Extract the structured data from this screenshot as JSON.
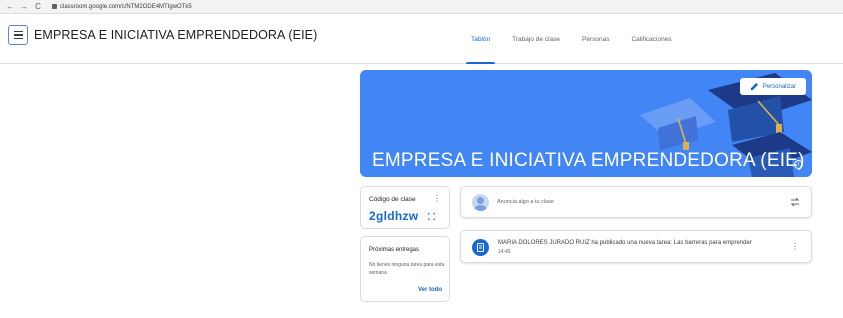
{
  "browser": {
    "back_glyph": "←",
    "forward_glyph": "→",
    "reload_glyph": "C",
    "url": "classroom.google.com/c/NTM2ODE4MTIgwOTk5"
  },
  "header": {
    "menu_icon": "hamburger-menu-icon",
    "class_title": "EMPRESA E INICIATIVA EMPRENDEDORA (EIE)",
    "tabs": [
      {
        "label": "Tablón",
        "active": true
      },
      {
        "label": "Trabajo de clase",
        "active": false
      },
      {
        "label": "Personas",
        "active": false
      },
      {
        "label": "Calificaciones",
        "active": false
      }
    ]
  },
  "banner": {
    "title": "EMPRESA E INICIATIVA EMPRENDEDORA (EIE)",
    "customize_label": "Personalizar",
    "info_glyph": "i",
    "background_color": "#4285f4",
    "decoration_color": "#1d3a88",
    "tassel_color": "#d8b24c"
  },
  "class_code": {
    "label": "Código de clase",
    "more_glyph": "⋮",
    "value": "2gldhzw"
  },
  "upcoming": {
    "title": "Próximas entregas",
    "text": "No tienes ninguna tarea para esta semana",
    "link": "Ver todo"
  },
  "announce": {
    "placeholder": "Anuncia algo a tu clase"
  },
  "stream": {
    "posts": [
      {
        "text": "MARIA DOLORES JURADO RUIZ ha publicado una nueva tarea: Las barreras para emprender",
        "time": "14:45",
        "more_glyph": "⋮"
      }
    ]
  },
  "accent_color": "#1967d2"
}
